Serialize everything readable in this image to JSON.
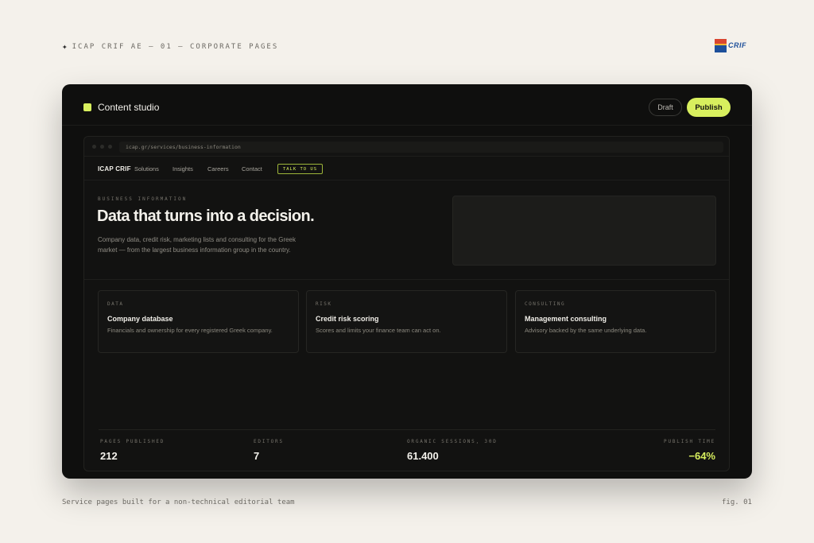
{
  "header_caption": "ICAP CRIF AE — 01 — CORPORATE PAGES",
  "brand_logo_text": "CRIF",
  "app": {
    "title": "Content studio",
    "draft_label": "Draft",
    "publish_label": "Publish",
    "accent_color": "#d8ef5e"
  },
  "browser": {
    "url": "icap.gr/services/business-information"
  },
  "site": {
    "logo": "ICAP CRIF",
    "nav": [
      "Solutions",
      "Insights",
      "Careers",
      "Contact"
    ],
    "cta": "TALK TO US"
  },
  "hero": {
    "eyebrow": "BUSINESS INFORMATION",
    "title": "Data that turns into a decision.",
    "body": "Company data, credit risk, marketing lists and consulting for the Greek market — from the largest business information group in the country."
  },
  "cards": [
    {
      "eyebrow": "DATA",
      "title": "Company database",
      "desc": "Financials and ownership for every registered Greek company."
    },
    {
      "eyebrow": "RISK",
      "title": "Credit risk scoring",
      "desc": "Scores and limits your finance team can act on."
    },
    {
      "eyebrow": "CONSULTING",
      "title": "Management consulting",
      "desc": "Advisory backed by the same underlying data."
    }
  ],
  "stats": [
    {
      "label": "PAGES PUBLISHED",
      "value": "212"
    },
    {
      "label": "EDITORS",
      "value": "7"
    },
    {
      "label": "ORGANIC SESSIONS, 30D",
      "value": "61.400"
    },
    {
      "label": "PUBLISH TIME",
      "value": "−64%"
    }
  ],
  "footer_caption": "Service pages built for a non-technical editorial team",
  "fig_label": "fig. 01"
}
